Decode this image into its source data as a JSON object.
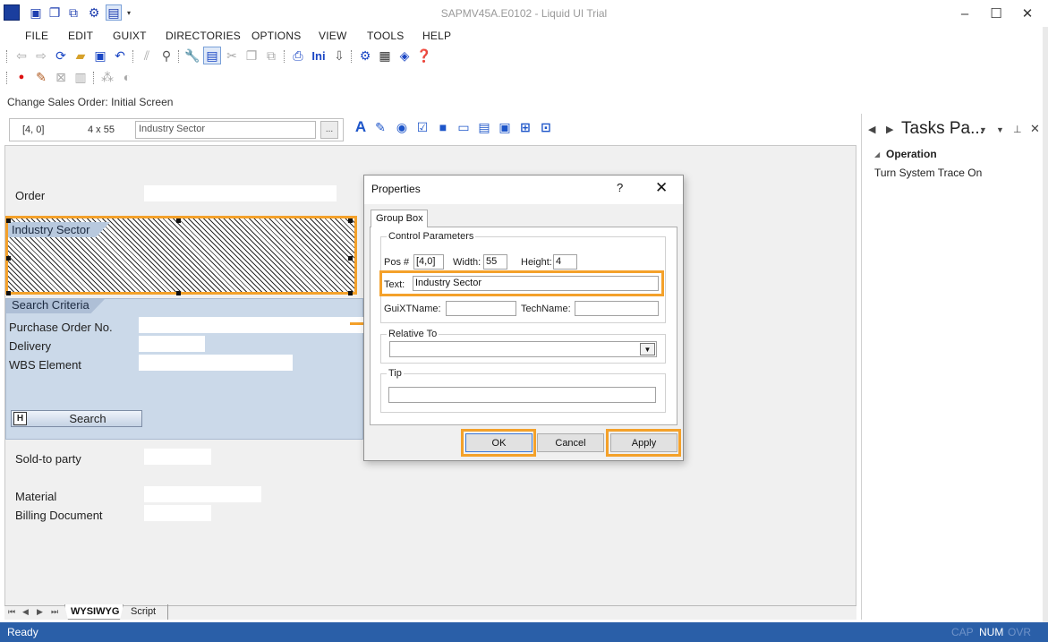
{
  "window": {
    "title": "SAPMV45A.E0102 - Liquid UI Trial"
  },
  "menu": [
    "FILE",
    "EDIT",
    "GUIXT",
    "DIRECTORIES",
    "OPTIONS",
    "VIEW",
    "TOOLS",
    "HELP"
  ],
  "screen_title": "Change Sales Order: Initial Screen",
  "prop_strip": {
    "pos": "[4, 0]",
    "size": "4 x 55",
    "text_value": "Industry Sector",
    "browse_label": "..."
  },
  "sap_screen": {
    "order_label": "Order",
    "industry_group_title": "Industry Sector",
    "search_group_title": "Search Criteria",
    "po_label": "Purchase Order No.",
    "delivery_label": "Delivery",
    "wbs_label": "WBS Element",
    "search_button": "Search",
    "search_button_icon": "H",
    "sold_to_label": "Sold-to party",
    "material_label": "Material",
    "billing_label": "Billing Document"
  },
  "editor_tabs": {
    "wysiwyg": "WYSIWYG",
    "script": "Script"
  },
  "dialog": {
    "title": "Properties",
    "help": "?",
    "close": "✕",
    "tab": "Group Box",
    "control_params_legend": "Control Parameters",
    "pos_label": "Pos #",
    "pos_value": "[4,0]",
    "width_label": "Width:",
    "width_value": "55",
    "height_label": "Height:",
    "height_value": "4",
    "text_label": "Text:",
    "text_value": "Industry Sector",
    "guixt_name_label": "GuiXTName:",
    "guixt_name_value": "",
    "tech_name_label": "TechName:",
    "tech_name_value": "",
    "relative_to_legend": "Relative To",
    "relative_to_value": "",
    "tip_legend": "Tip",
    "tip_value": "",
    "ok": "OK",
    "cancel": "Cancel",
    "apply": "Apply"
  },
  "task_pane": {
    "title": "Tasks Pa...",
    "section": "Operation",
    "item": "Turn System Trace On"
  },
  "status": {
    "text": "Ready",
    "cap": "CAP",
    "num": "NUM",
    "ovr": "OVR"
  },
  "colors": {
    "highlight": "#f4a12a",
    "status_bar": "#2a5fa8",
    "search_group_bg": "#cbd9e9",
    "icon_blue": "#1a46c4"
  }
}
